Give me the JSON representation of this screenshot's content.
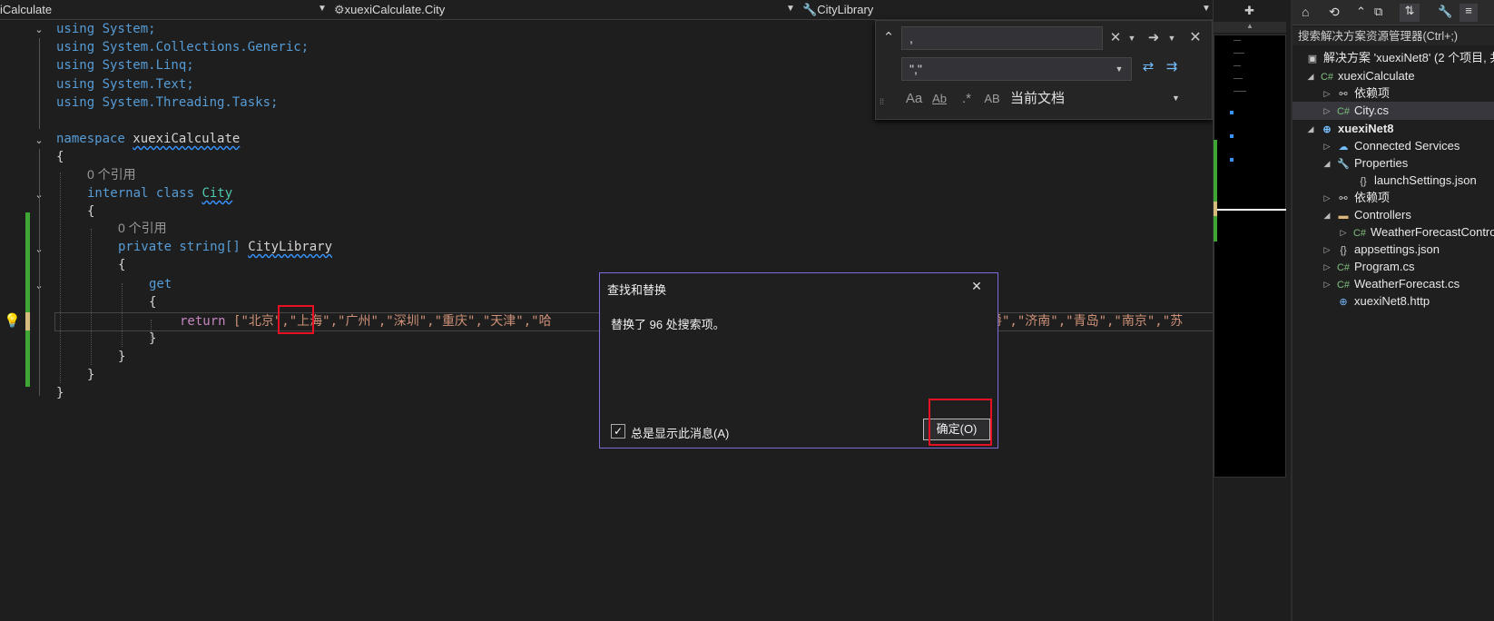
{
  "navbar": {
    "project": "iCalculate",
    "type": "xuexiCalculate.City",
    "member": "CityLibrary"
  },
  "code": {
    "l1": "using System;",
    "l2": "using System.Collections.Generic;",
    "l3": "using System.Linq;",
    "l4": "using System.Text;",
    "l5": "using System.Threading.Tasks;",
    "ns_kw": "namespace",
    "ns_name": "xuexiCalculate",
    "ref1": "0 个引用",
    "class_mods": "internal class",
    "class_name": "City",
    "ref2": "0 个引用",
    "prop_mods": "private string[]",
    "prop_name": "CityLibrary",
    "get": "get",
    "ret_kw": "return",
    "ret_val": "[\"北京\",\"上海\",\"广州\",\"深圳\",\"重庆\",\"天津\",\"哈",
    "ret_tail": "爵\",\"济南\",\"青岛\",\"南京\",\"苏"
  },
  "find": {
    "search_value": ",",
    "replace_value": "\",\"",
    "scope": "当前文档",
    "opt_case": "Aa",
    "opt_word": "Ab",
    "opt_regex": ".*",
    "opt_preserve": "AB"
  },
  "dialog": {
    "title": "查找和替换",
    "message": "替换了 96 处搜索项。",
    "checkbox_label": "总是显示此消息(A)",
    "ok_label": "确定(O)"
  },
  "solution": {
    "search_placeholder": "搜索解决方案资源管理器(Ctrl+;)",
    "root": "解决方案 'xuexiNet8' (2 个项目, 共",
    "items": [
      {
        "label": "xuexiCalculate"
      },
      {
        "label": "依赖项"
      },
      {
        "label": "City.cs"
      },
      {
        "label": "xuexiNet8"
      },
      {
        "label": "Connected Services"
      },
      {
        "label": "Properties"
      },
      {
        "label": "launchSettings.json"
      },
      {
        "label": "依赖项"
      },
      {
        "label": "Controllers"
      },
      {
        "label": "WeatherForecastController.cs"
      },
      {
        "label": "appsettings.json"
      },
      {
        "label": "Program.cs"
      },
      {
        "label": "WeatherForecast.cs"
      },
      {
        "label": "xuexiNet8.http"
      }
    ]
  },
  "colors": {
    "accent": "#7e6bd8",
    "highlight_box": "#e81123",
    "change_bar": "#3fa535"
  }
}
